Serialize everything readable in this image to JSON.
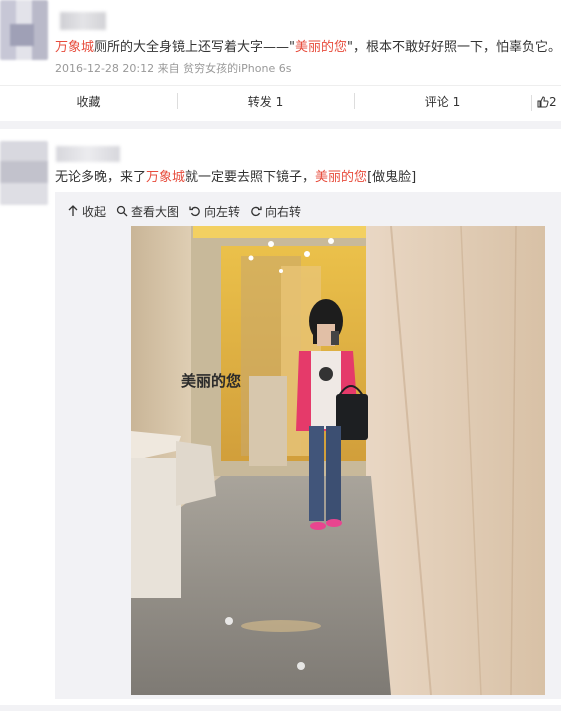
{
  "post1": {
    "text_link1": "万象城",
    "text_part1": "厕所的大全身镜上还写着大字——\"",
    "text_link2": "美丽的您",
    "text_part2": "\"，根本不敢好好照一下，怕辜负它。",
    "meta": "2016-12-28 20:12 来自 贫穷女孩的iPhone 6s",
    "actions": {
      "collect": "收藏",
      "repost": "转发 1",
      "comment": "评论 1",
      "like": "2"
    }
  },
  "post2": {
    "text_part1": "无论多晚，来了",
    "text_link1": "万象城",
    "text_part2": "就一定要去照下镜子，",
    "text_link2": "美丽的您",
    "text_part3": "[做鬼脸]",
    "toolbar": {
      "collapse": "收起",
      "view_large": "查看大图",
      "rotate_left": "向左转",
      "rotate_right": "向右转"
    },
    "mirror_text": "美丽的您"
  },
  "colors": {
    "link": "#e74c3c",
    "meta": "#999999",
    "media_bg": "#f2f2f5"
  }
}
